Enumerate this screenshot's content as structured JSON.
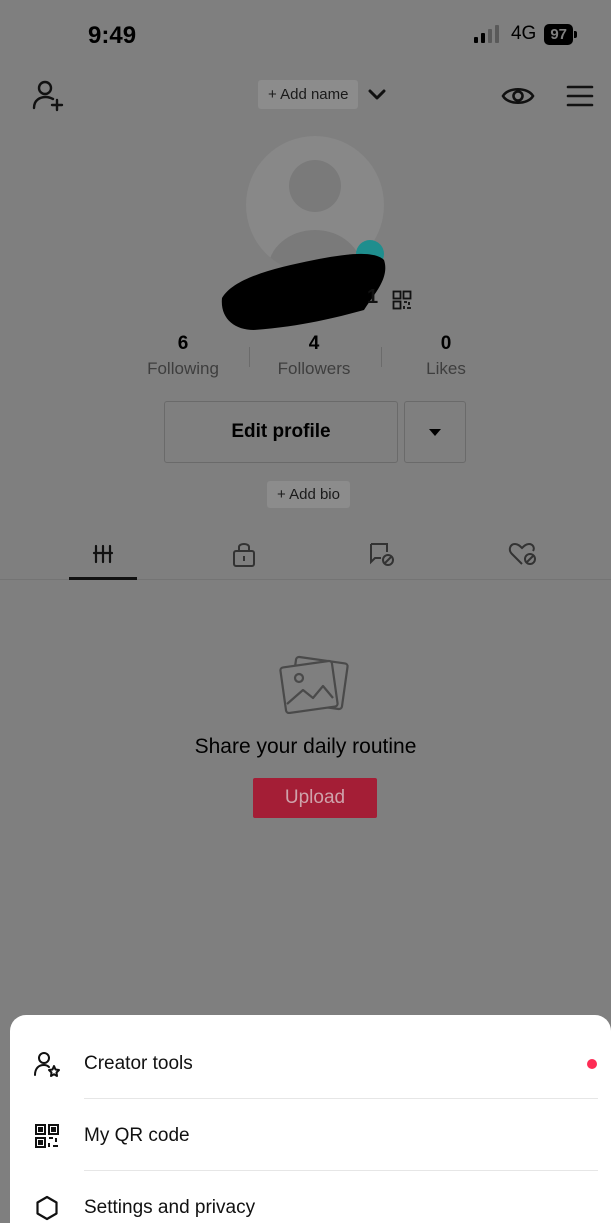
{
  "status_bar": {
    "time": "9:49",
    "network": "4G",
    "battery": "97"
  },
  "header": {
    "add_name_label": "+ Add name"
  },
  "profile": {
    "username_suffix": "1",
    "stats": [
      {
        "value": "6",
        "label": "Following"
      },
      {
        "value": "4",
        "label": "Followers"
      },
      {
        "value": "0",
        "label": "Likes"
      }
    ],
    "edit_profile_label": "Edit profile",
    "add_bio_label": "+ Add bio"
  },
  "tabs": [
    {
      "icon": "grid-icon",
      "active": true
    },
    {
      "icon": "lock-icon",
      "active": false
    },
    {
      "icon": "tagged-hidden-icon",
      "active": false
    },
    {
      "icon": "liked-hidden-icon",
      "active": false
    }
  ],
  "empty_state": {
    "icon": "gallery-icon",
    "title": "Share your daily routine",
    "upload_label": "Upload"
  },
  "menu_sheet": {
    "items": [
      {
        "label": "Creator tools",
        "icon": "person-star-icon",
        "has_notification": true
      },
      {
        "label": "My QR code",
        "icon": "qr-code-icon",
        "has_notification": false
      },
      {
        "label": "Settings and privacy",
        "icon": "gear-icon",
        "has_notification": false
      }
    ]
  },
  "colors": {
    "overlay_bg": "#7f7f7f",
    "upload_button": "#a41e36",
    "notification_dot": "#fe2c55",
    "sheet_bg": "#ffffff"
  }
}
